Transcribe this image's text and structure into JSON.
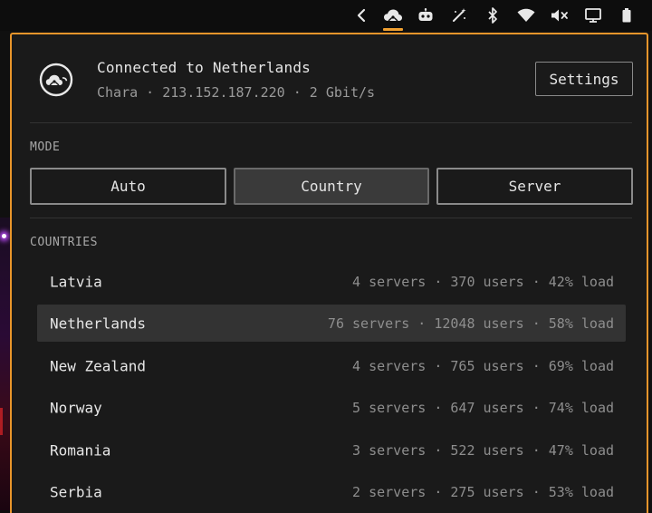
{
  "tray": {
    "active_indicator_color": "#f0a030",
    "icons": [
      "chevron-left-icon",
      "vpn-cloud-icon",
      "robot-icon",
      "wand-icon",
      "bluetooth-icon",
      "wifi-icon",
      "volume-muted-icon",
      "display-icon",
      "battery-icon"
    ]
  },
  "status": {
    "title": "Connected to Netherlands",
    "subtitle": "Chara · 213.152.187.220 · 2 Gbit/s",
    "settings_label": "Settings"
  },
  "mode": {
    "label": "MODE",
    "options": [
      "Auto",
      "Country",
      "Server"
    ],
    "selected": "Country"
  },
  "countries": {
    "label": "COUNTRIES",
    "items": [
      {
        "name": "Latvia",
        "stats": "4 servers · 370 users · 42% load"
      },
      {
        "name": "Netherlands",
        "stats": "76 servers · 12048 users · 58% load",
        "selected": true
      },
      {
        "name": "New Zealand",
        "stats": "4 servers · 765 users · 69% load"
      },
      {
        "name": "Norway",
        "stats": "5 servers · 647 users · 74% load"
      },
      {
        "name": "Romania",
        "stats": "3 servers · 522 users · 47% load"
      },
      {
        "name": "Serbia",
        "stats": "2 servers · 275 users · 53% load"
      }
    ]
  },
  "colors": {
    "accent": "#e8952b",
    "panel_bg": "#1a1a1a",
    "selected_row_bg": "#333333"
  }
}
